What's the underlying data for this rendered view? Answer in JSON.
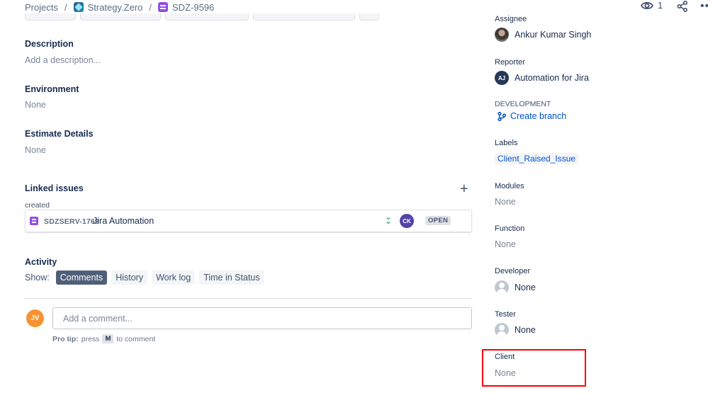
{
  "breadcrumb": {
    "projects": "Projects",
    "separator": "/",
    "project": "Strategy.Zero",
    "issue_key": "SDZ-9596"
  },
  "top_actions": {
    "watch_count": "1"
  },
  "main": {
    "description": {
      "heading": "Description",
      "placeholder": "Add a description..."
    },
    "environment": {
      "heading": "Environment",
      "value": "None"
    },
    "estimate": {
      "heading": "Estimate Details",
      "value": "None"
    },
    "linked_issues": {
      "heading": "Linked issues",
      "relation": "created",
      "items": [
        {
          "key": "SDZSERV-1769",
          "summary": "Jira Automation",
          "assignee_initials": "CK",
          "status": "OPEN"
        }
      ]
    },
    "activity": {
      "heading": "Activity",
      "show_label": "Show:",
      "tabs": [
        "Comments",
        "History",
        "Work log",
        "Time in Status"
      ],
      "active_tab": "Comments"
    },
    "comment": {
      "avatar_initials": "JV",
      "placeholder": "Add a comment...",
      "protip_label": "Pro tip:",
      "protip_press": "press",
      "protip_key": "M",
      "protip_suffix": "to comment"
    }
  },
  "sidebar": {
    "assignee": {
      "label": "Assignee",
      "value": "Ankur Kumar Singh"
    },
    "reporter": {
      "label": "Reporter",
      "value": "Automation for Jira",
      "initials": "AJ"
    },
    "development": {
      "label": "DEVELOPMENT",
      "action": "Create branch"
    },
    "labels": {
      "label": "Labels",
      "value": "Client_Raised_Issue"
    },
    "modules": {
      "label": "Modules",
      "value": "None"
    },
    "function": {
      "label": "Function",
      "value": "None"
    },
    "developer": {
      "label": "Developer",
      "value": "None"
    },
    "tester": {
      "label": "Tester",
      "value": "None"
    },
    "client": {
      "label": "Client",
      "value": "None"
    }
  },
  "colors": {
    "highlight": "#ff0000",
    "link": "#0052cc",
    "active_tab": "#505f79",
    "story_purple": "#904ee2"
  },
  "icons": [
    "project-icon",
    "issue-type-icon",
    "eye-icon",
    "share-icon",
    "more-icon",
    "plus-icon",
    "priority-lowest-icon",
    "branch-icon",
    "user-placeholder-icon"
  ]
}
